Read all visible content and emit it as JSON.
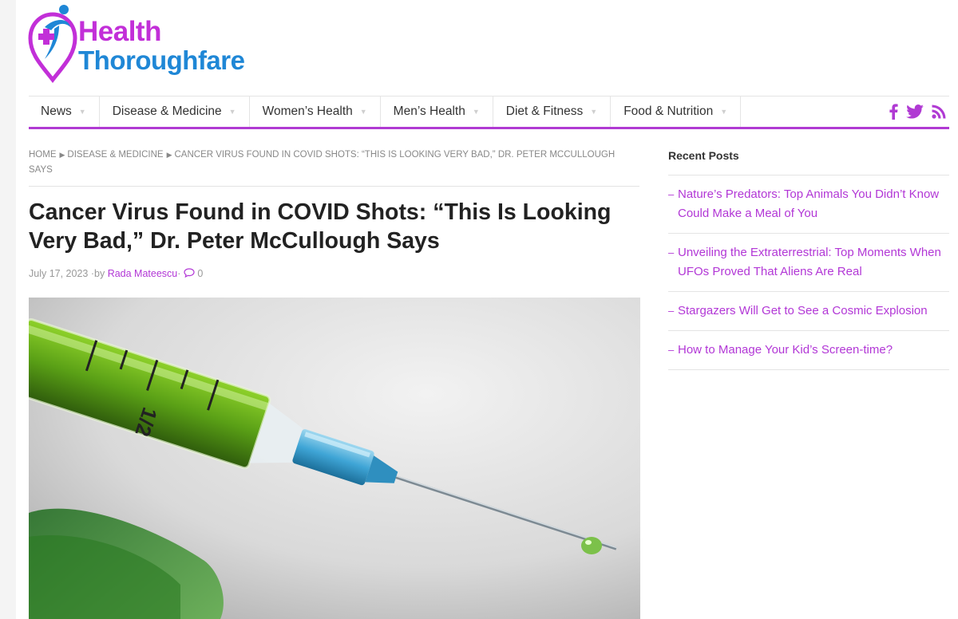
{
  "site": {
    "logo_line1": "Health",
    "logo_line2": "Thoroughfare",
    "colors": {
      "brand_purple": "#c22fd8",
      "brand_blue": "#1f87d6",
      "accent": "#b03ad3"
    }
  },
  "nav": {
    "items": [
      {
        "label": "News"
      },
      {
        "label": "Disease & Medicine"
      },
      {
        "label": "Women’s Health"
      },
      {
        "label": "Men’s Health"
      },
      {
        "label": "Diet & Fitness"
      },
      {
        "label": "Food & Nutrition"
      }
    ],
    "social_icons": [
      "facebook-icon",
      "twitter-icon",
      "rss-icon"
    ]
  },
  "breadcrumb": {
    "home": "HOME",
    "category": "DISEASE & MEDICINE",
    "current": "CANCER VIRUS FOUND IN COVID SHOTS: “THIS IS LOOKING VERY BAD,” DR. PETER MCCULLOUGH SAYS"
  },
  "article": {
    "title": "Cancer Virus Found in COVID Shots: “This Is Looking Very Bad,” Dr. Peter McCullough Says",
    "date": "July 17, 2023",
    "by": "·by",
    "author": "Rada Mateescu",
    "comments": "0"
  },
  "sidebar": {
    "title": "Recent Posts",
    "posts": [
      {
        "title": "Nature’s Predators: Top Animals You Didn’t Know Could Make a Meal of You"
      },
      {
        "title": "Unveiling the Extraterrestrial: Top Moments When UFOs Proved That Aliens Are Real"
      },
      {
        "title": "Stargazers Will Get to See a Cosmic Explosion"
      },
      {
        "title": "How to Manage Your Kid’s Screen-time?"
      }
    ]
  }
}
